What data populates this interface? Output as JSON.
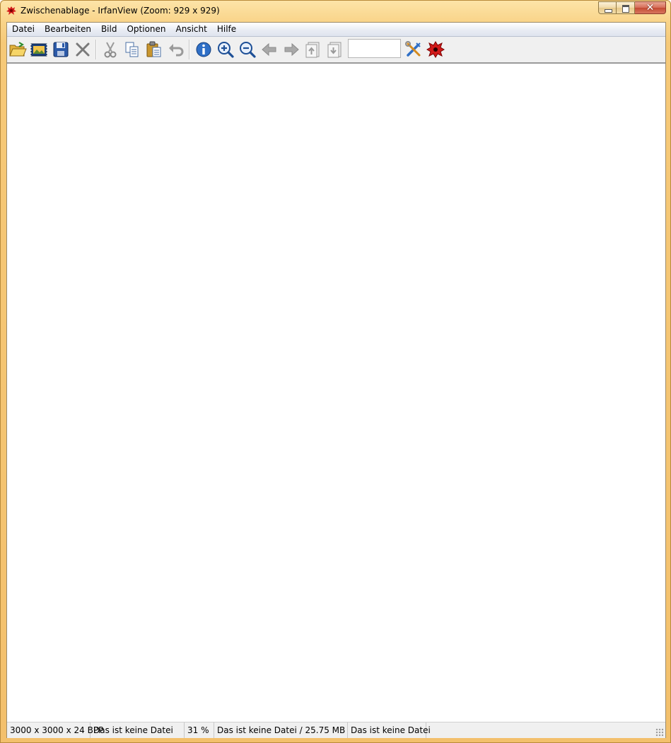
{
  "window": {
    "title": "Zwischenablage - IrfanView (Zoom: 929 x 929)",
    "controls": {
      "minimize": "minimize",
      "maximize": "maximize",
      "close": "✕"
    }
  },
  "menubar": {
    "items": [
      "Datei",
      "Bearbeiten",
      "Bild",
      "Optionen",
      "Ansicht",
      "Hilfe"
    ]
  },
  "toolbar": {
    "buttons": [
      {
        "icon": "open-folder-icon"
      },
      {
        "icon": "slideshow-icon"
      },
      {
        "icon": "save-icon"
      },
      {
        "icon": "delete-icon"
      },
      {
        "icon": "cut-icon"
      },
      {
        "icon": "copy-icon"
      },
      {
        "icon": "paste-icon"
      },
      {
        "icon": "undo-icon"
      },
      {
        "icon": "info-icon"
      },
      {
        "icon": "zoom-in-icon"
      },
      {
        "icon": "zoom-out-icon"
      },
      {
        "icon": "previous-icon"
      },
      {
        "icon": "next-icon"
      },
      {
        "icon": "first-page-icon"
      },
      {
        "icon": "last-page-icon"
      },
      {
        "icon": "settings-icon"
      },
      {
        "icon": "irfanview-icon"
      }
    ],
    "page_field_value": ""
  },
  "statusbar": {
    "image_info": "3000 x 3000 x 24 BPP",
    "field2": "Das ist keine Datei",
    "zoom": "31 %",
    "file_size": "Das ist keine Datei / 25.75 MB",
    "field5": "Das ist keine Datei"
  },
  "colors": {
    "frame": "#f6c978",
    "info_blue": "#2f6fc6",
    "irfan_red": "#d11a1a"
  }
}
